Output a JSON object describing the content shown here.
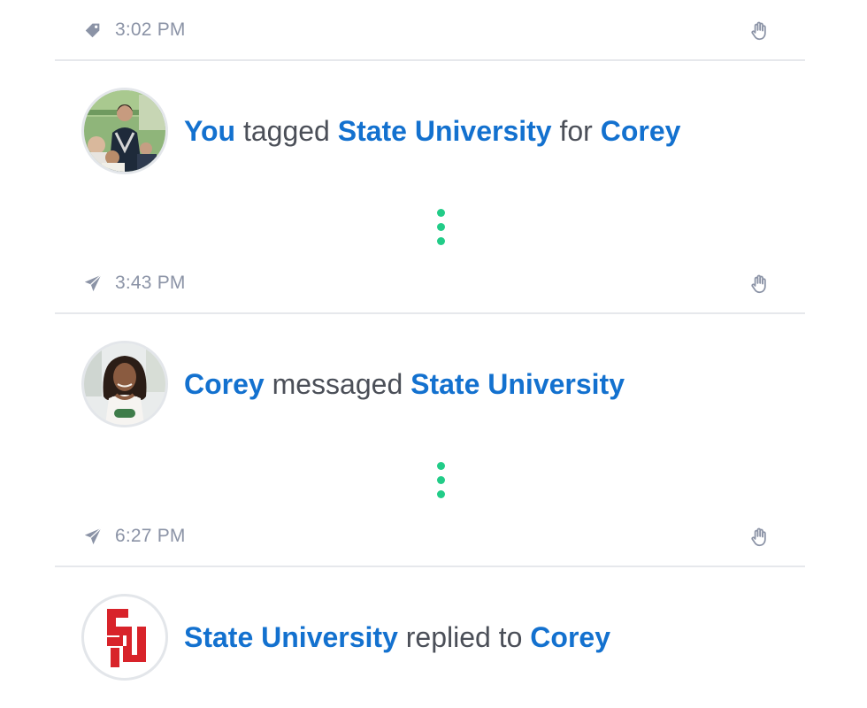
{
  "feed": {
    "events": [
      {
        "meta": {
          "icon": "tag-icon",
          "time": "3:02 PM"
        },
        "avatar": "user-you-avatar",
        "text": {
          "actor": "You",
          "verb": "tagged",
          "object": "State University",
          "prep": "for",
          "target": "Corey"
        }
      },
      {
        "meta": {
          "icon": "send-icon",
          "time": "3:43 PM"
        },
        "avatar": "user-corey-avatar",
        "text": {
          "actor": "Corey",
          "verb": "messaged",
          "object": "State University"
        }
      },
      {
        "meta": {
          "icon": "send-icon",
          "time": "6:27 PM"
        },
        "avatar": "state-university-logo",
        "text": {
          "actor": "State University",
          "verb": "replied to",
          "object": "Corey"
        }
      }
    ]
  },
  "colors": {
    "link": "#1371cf",
    "meta_text": "#8b93a6",
    "connector_dots": "#22cc88",
    "divider": "#e6e8ec",
    "logo_red": "#d8232a"
  }
}
